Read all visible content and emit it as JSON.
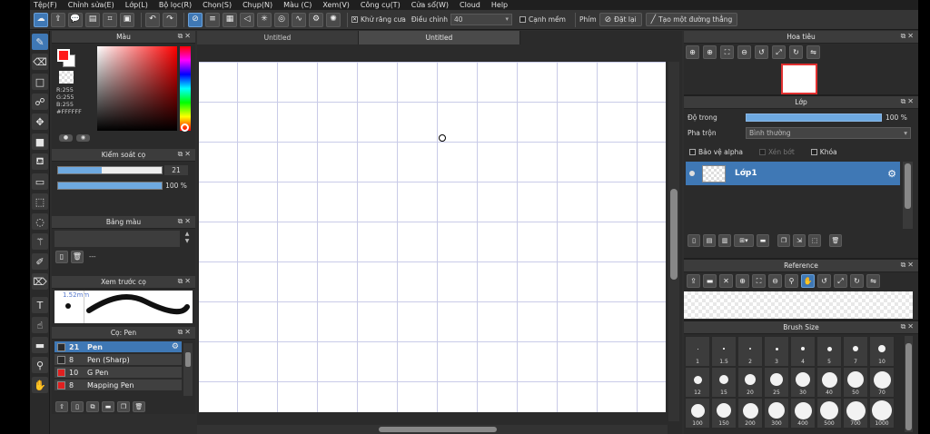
{
  "menu": [
    "Tệp(F)",
    "Chỉnh sửa(E)",
    "Lớp(L)",
    "Bộ lọc(R)",
    "Chọn(S)",
    "Chụp(N)",
    "Màu (C)",
    "Xem(V)",
    "Công cụ(T)",
    "Cửa sổ(W)",
    "Cloud",
    "Help"
  ],
  "toolbar": {
    "antialias_label": "Khử răng cưa",
    "adjust_label": "Điều chỉnh",
    "adjust_value": "40",
    "smooth_label": "Cạnh mềm",
    "key_label": "Phím",
    "reset_label": "Đặt lại",
    "line_label": "Tạo một đường thẳng"
  },
  "panels": {
    "color": "Màu",
    "brush_control": "Kiểm soát cọ",
    "palette": "Bảng màu",
    "brush_preview": "Xem trước cọ",
    "brush": "Cọ: Pen",
    "navigator": "Hoa tiêu",
    "layer": "Lớp",
    "reference": "Reference",
    "brush_size": "Brush Size"
  },
  "color": {
    "fg": "#ff1a1a",
    "r": "R:255",
    "g": "G:255",
    "b": "B:255",
    "hex": "#FFFFFF"
  },
  "brush_control": {
    "size_value": "21",
    "size_fraction": 0.42,
    "opacity_value": "100 %",
    "opacity_fraction": 1.0
  },
  "palette": {
    "dash": "---"
  },
  "preview": {
    "size_label": "1.52mm"
  },
  "brushes": [
    {
      "num": "21",
      "name": "Pen",
      "color": "#2a2a2a",
      "selected": true
    },
    {
      "num": "8",
      "name": "Pen (Sharp)",
      "color": "#2a2a2a",
      "selected": false
    },
    {
      "num": "10",
      "name": "G Pen",
      "color": "#e02020",
      "selected": false
    },
    {
      "num": "8",
      "name": "Mapping Pen",
      "color": "#e02020",
      "selected": false
    }
  ],
  "tabs": [
    "Untitled",
    "Untitled"
  ],
  "layer": {
    "opacity_label": "Độ trong",
    "opacity_value": "100 %",
    "blend_label": "Pha trộn",
    "blend_value": "Bình thường",
    "protect_alpha": "Bảo vệ alpha",
    "clipping": "Xén bớt",
    "lock": "Khóa",
    "layer_name": "Lớp1"
  },
  "brush_sizes": [
    "1",
    "1.5",
    "2",
    "3",
    "4",
    "5",
    "7",
    "10",
    "12",
    "15",
    "20",
    "25",
    "30",
    "40",
    "50",
    "70",
    "100",
    "150",
    "200",
    "300",
    "400",
    "500",
    "700",
    "1000"
  ]
}
